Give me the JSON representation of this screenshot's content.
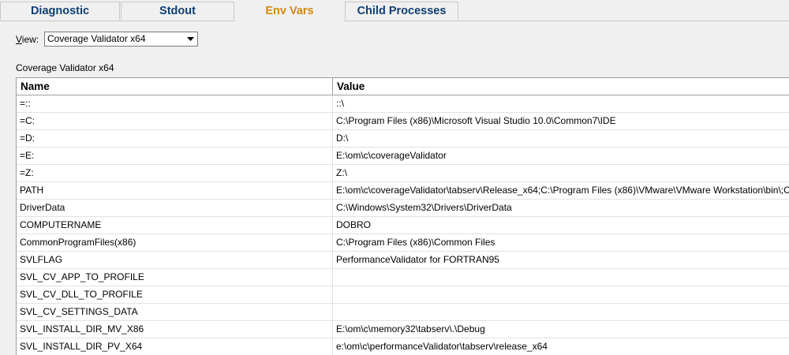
{
  "tabs": [
    {
      "label": "Diagnostic",
      "active": false
    },
    {
      "label": "Stdout",
      "active": false
    },
    {
      "label": "Env Vars",
      "active": true
    },
    {
      "label": "Child Processes",
      "active": false
    }
  ],
  "view": {
    "label_underlined": "V",
    "label_rest": "iew:",
    "selected": "Coverage Validator x64"
  },
  "section_title": "Coverage Validator x64",
  "table": {
    "columns": [
      "Name",
      "Value"
    ],
    "rows": [
      {
        "name": "=::",
        "value": "::\\"
      },
      {
        "name": "=C:",
        "value": "C:\\Program Files (x86)\\Microsoft Visual Studio 10.0\\Common7\\IDE"
      },
      {
        "name": "=D:",
        "value": "D:\\"
      },
      {
        "name": "=E:",
        "value": "E:\\om\\c\\coverageValidator"
      },
      {
        "name": "=Z:",
        "value": "Z:\\"
      },
      {
        "name": "PATH",
        "value": "E:\\om\\c\\coverageValidator\\tabserv\\Release_x64;C:\\Program Files (x86)\\VMware\\VMware Workstation\\bin\\;C:"
      },
      {
        "name": "DriverData",
        "value": "C:\\Windows\\System32\\Drivers\\DriverData"
      },
      {
        "name": "COMPUTERNAME",
        "value": "DOBRO"
      },
      {
        "name": "CommonProgramFiles(x86)",
        "value": "C:\\Program Files (x86)\\Common Files"
      },
      {
        "name": "SVLFLAG",
        "value": "PerformanceValidator for FORTRAN95"
      },
      {
        "name": "SVL_CV_APP_TO_PROFILE",
        "value": ""
      },
      {
        "name": "SVL_CV_DLL_TO_PROFILE",
        "value": ""
      },
      {
        "name": "SVL_CV_SETTINGS_DATA",
        "value": ""
      },
      {
        "name": "SVL_INSTALL_DIR_MV_X86",
        "value": "E:\\om\\c\\memory32\\tabserv\\.\\Debug"
      },
      {
        "name": "SVL_INSTALL_DIR_PV_X64",
        "value": "e:\\om\\c\\performanceValidator\\tabserv\\release_x64"
      }
    ]
  }
}
